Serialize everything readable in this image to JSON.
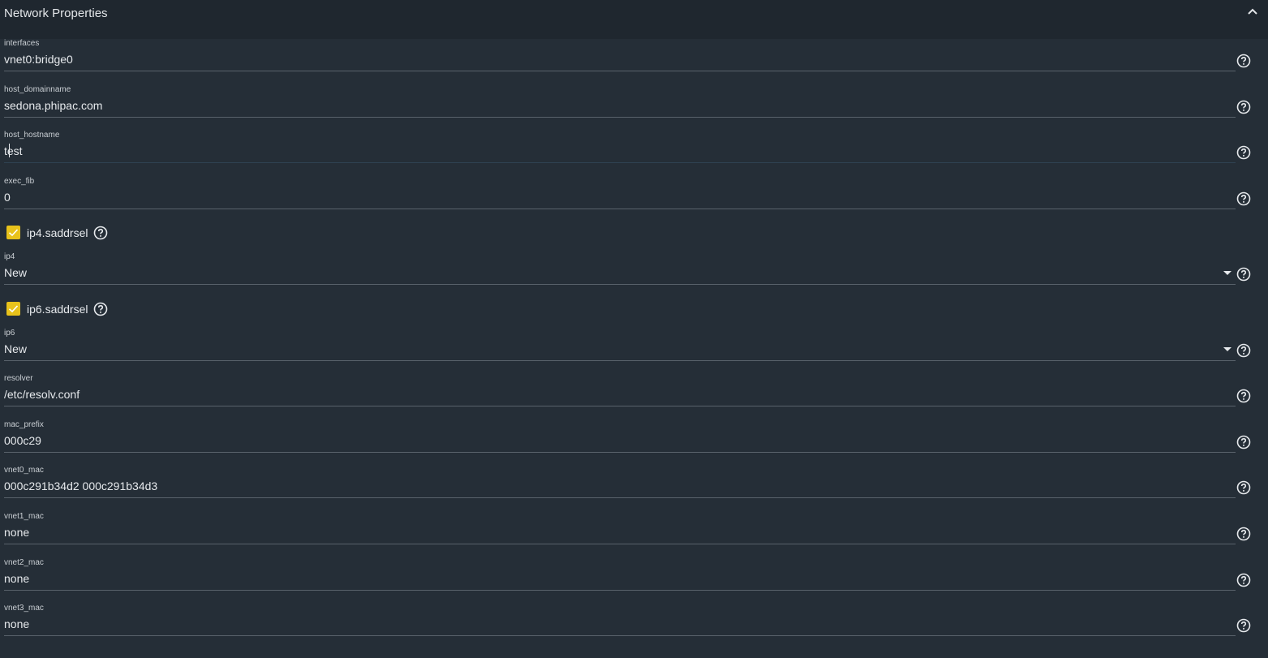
{
  "header": {
    "title": "Network Properties",
    "collapse_icon": "chevron-up-icon"
  },
  "fields": {
    "interfaces": {
      "label": "interfaces",
      "value": "vnet0:bridge0"
    },
    "host_domainname": {
      "label": "host_domainname",
      "value": "sedona.phipac.com"
    },
    "host_hostname": {
      "label": "host_hostname",
      "value": "test"
    },
    "exec_fib": {
      "label": "exec_fib",
      "value": "0"
    },
    "ip4": {
      "label": "ip4",
      "value": "New"
    },
    "ip6": {
      "label": "ip6",
      "value": "New"
    },
    "resolver": {
      "label": "resolver",
      "value": "/etc/resolv.conf"
    },
    "mac_prefix": {
      "label": "mac_prefix",
      "value": "000c29"
    },
    "vnet0_mac": {
      "label": "vnet0_mac",
      "value": "000c291b34d2 000c291b34d3"
    },
    "vnet1_mac": {
      "label": "vnet1_mac",
      "value": "none"
    },
    "vnet2_mac": {
      "label": "vnet2_mac",
      "value": "none"
    },
    "vnet3_mac": {
      "label": "vnet3_mac",
      "value": "none"
    }
  },
  "checkboxes": {
    "ip4_saddrsel": {
      "label": "ip4.saddrsel",
      "checked": true
    },
    "ip6_saddrsel": {
      "label": "ip6.saddrsel",
      "checked": true
    }
  },
  "colors": {
    "background": "#252e37",
    "header_background": "#1f272f",
    "checkbox_accent": "#e8c21b",
    "text": "#e6e9ec",
    "underline": "#59626b"
  },
  "icons": {
    "help": "help-circle-icon",
    "dropdown": "caret-down-icon",
    "check": "check-icon"
  }
}
